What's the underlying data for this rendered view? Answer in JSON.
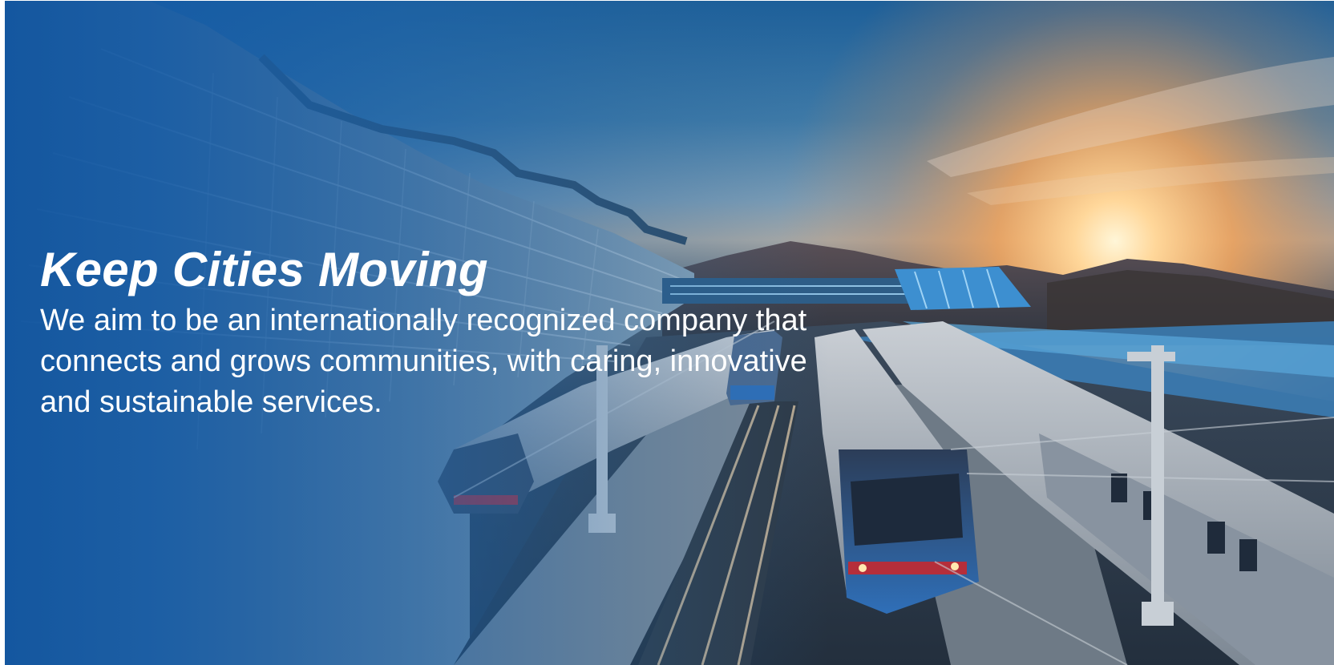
{
  "hero": {
    "headline": "Keep Cities Moving",
    "description": "We aim to be an internationally recognized company that connects and grows communities, with caring, innovative and sustainable services."
  },
  "colors": {
    "brand_blue": "#1256a0",
    "text": "#ffffff",
    "sunset": "#f2a65a"
  }
}
